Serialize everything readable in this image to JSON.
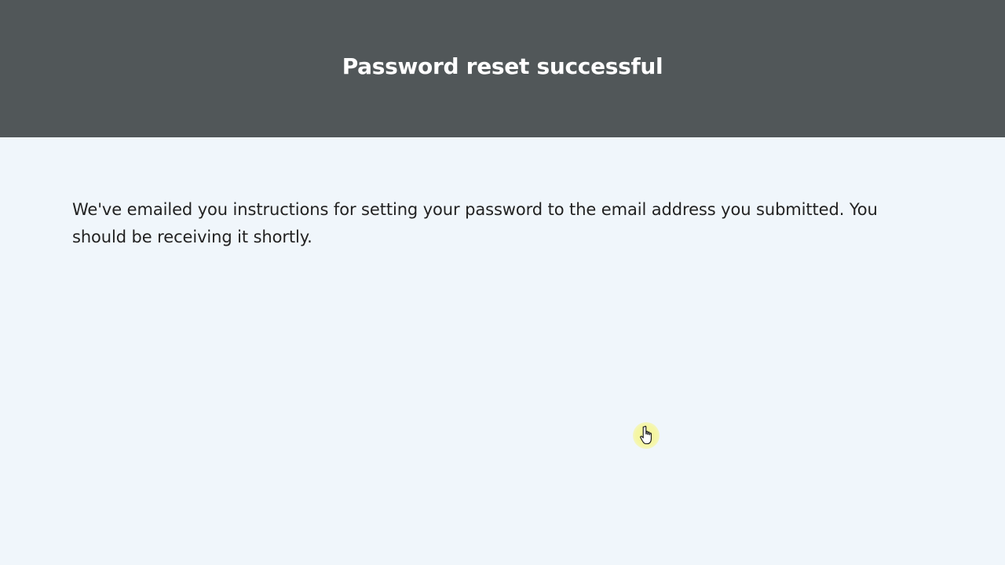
{
  "header": {
    "title": "Password reset successful",
    "background_color": "#515759"
  },
  "main": {
    "message": "We've emailed you instructions for setting your password to the email address you submitted. You should be receiving it shortly.",
    "background_color": "#f0f6fb"
  },
  "cursor": {
    "icon": "hand-pointer-icon"
  }
}
